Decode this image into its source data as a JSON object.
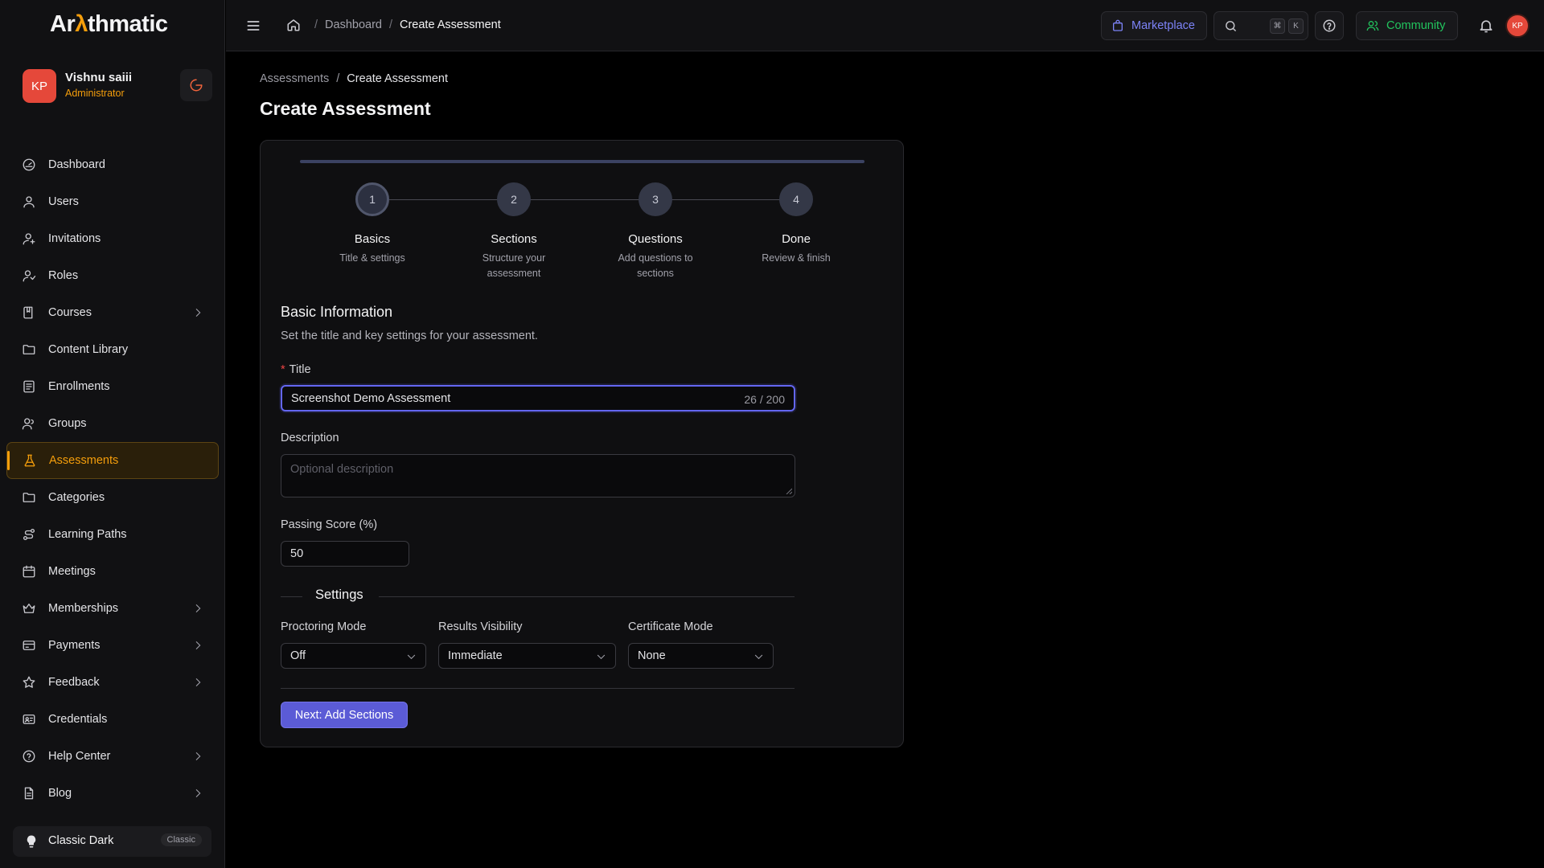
{
  "app": {
    "logo_prefix": "Ar",
    "logo_accent": "λ",
    "logo_suffix": "thmatic",
    "accent_color": "#f59e0b",
    "primary_color": "#5b5bd6"
  },
  "user": {
    "initials": "KP",
    "name": "Vishnu saiii",
    "role": "Administrator"
  },
  "sidebar": {
    "items": [
      {
        "label": "Dashboard",
        "icon": "dashboard-icon"
      },
      {
        "label": "Users",
        "icon": "user-icon"
      },
      {
        "label": "Invitations",
        "icon": "user-plus-icon"
      },
      {
        "label": "Roles",
        "icon": "roles-icon"
      },
      {
        "label": "Courses",
        "icon": "book-icon",
        "expandable": true
      },
      {
        "label": "Content Library",
        "icon": "folder-icon"
      },
      {
        "label": "Enrollments",
        "icon": "list-icon"
      },
      {
        "label": "Groups",
        "icon": "group-icon"
      },
      {
        "label": "Assessments",
        "icon": "flask-icon",
        "active": true
      },
      {
        "label": "Categories",
        "icon": "folder-icon"
      },
      {
        "label": "Learning Paths",
        "icon": "route-icon"
      },
      {
        "label": "Meetings",
        "icon": "calendar-icon"
      },
      {
        "label": "Memberships",
        "icon": "crown-icon",
        "expandable": true
      },
      {
        "label": "Payments",
        "icon": "credit-card-icon",
        "expandable": true
      },
      {
        "label": "Feedback",
        "icon": "star-icon",
        "expandable": true
      },
      {
        "label": "Credentials",
        "icon": "id-card-icon"
      },
      {
        "label": "Help Center",
        "icon": "help-circle-icon",
        "expandable": true
      },
      {
        "label": "Blog",
        "icon": "document-icon",
        "expandable": true
      }
    ],
    "theme": {
      "label": "Classic Dark",
      "badge": "Classic"
    }
  },
  "topbar": {
    "breadcrumb": [
      "Dashboard",
      "Create Assessment"
    ],
    "marketplace": "Marketplace",
    "shortcut_keys": [
      "⌘",
      "K"
    ],
    "community": "Community",
    "avatar_initials": "KP"
  },
  "page": {
    "breadcrumb": [
      "Assessments",
      "Create Assessment"
    ],
    "title": "Create Assessment"
  },
  "stepper": {
    "steps": [
      {
        "num": "1",
        "title": "Basics",
        "desc": "Title & settings"
      },
      {
        "num": "2",
        "title": "Sections",
        "desc": "Structure your assessment"
      },
      {
        "num": "3",
        "title": "Questions",
        "desc": "Add questions to sections"
      },
      {
        "num": "4",
        "title": "Done",
        "desc": "Review & finish"
      }
    ],
    "current": 1
  },
  "form": {
    "section_title": "Basic Information",
    "section_desc": "Set the title and key settings for your assessment.",
    "title_label": "Title",
    "title_required_mark": "*",
    "title_value": "Screenshot Demo Assessment",
    "title_counter": "26 / 200",
    "description_label": "Description",
    "description_placeholder": "Optional description",
    "passing_label": "Passing Score (%)",
    "passing_value": "50",
    "settings_title": "Settings",
    "proctoring_label": "Proctoring Mode",
    "proctoring_value": "Off",
    "visibility_label": "Results Visibility",
    "visibility_value": "Immediate",
    "certificate_label": "Certificate Mode",
    "certificate_value": "None",
    "next_button": "Next: Add Sections"
  }
}
